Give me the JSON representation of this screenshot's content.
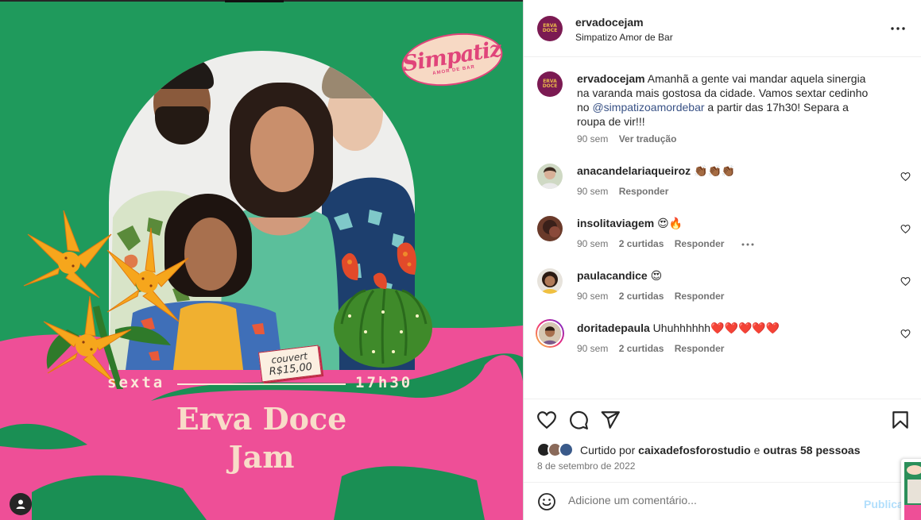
{
  "post": {
    "image": {
      "logo_badge": {
        "main": "Simpatiz",
        "sub": "AMOR DE BAR"
      },
      "ticket": {
        "line1": "couvert",
        "line2": "R$15,00"
      },
      "day": "sexta",
      "time": "17h30",
      "title_line1": "Erva Doce",
      "title_line2": "Jam",
      "colors": {
        "green": "#1f9a5c",
        "pink": "#ee4f97",
        "cream": "#f8dcc8"
      },
      "user_tag_icon": "person-icon"
    }
  },
  "header": {
    "username": "ervadocejam",
    "location": "Simpatizo Amor de Bar",
    "avatar_text": "ERVA DOCE",
    "more_icon": "more-horizontal-icon"
  },
  "caption": {
    "username": "ervadocejam",
    "text_before": " Amanhã a gente vai mandar aquela sinergia na varanda mais gostosa da cidade. Vamos sextar cedinho no ",
    "mention": "@simpatizoamordebar",
    "text_after": " a partir das 17h30! Separa a roupa de vir!!!",
    "time": "90 sem",
    "translate": "Ver tradução"
  },
  "comments": [
    {
      "username": "anacandelariaqueiroz",
      "text": " 👏🏾👏🏾👏🏾",
      "time": "90 sem",
      "likes": "",
      "reply": "Responder",
      "more": false
    },
    {
      "username": "insolitaviagem",
      "text": " 😍🔥",
      "time": "90 sem",
      "likes": "2 curtidas",
      "reply": "Responder",
      "more": true
    },
    {
      "username": "paulacandice",
      "text": " 😍",
      "time": "90 sem",
      "likes": "2 curtidas",
      "reply": "Responder",
      "more": false
    },
    {
      "username": "doritadepaula",
      "text": " Uhuhhhhhh❤️❤️❤️❤️❤️",
      "time": "90 sem",
      "likes": "2 curtidas",
      "reply": "Responder",
      "more": false
    }
  ],
  "actions": {
    "like_icon": "heart-icon",
    "comment_icon": "comment-icon",
    "share_icon": "send-icon",
    "save_icon": "bookmark-icon"
  },
  "likes": {
    "prefix": "Curtido por ",
    "user": "caixadefosforostudio",
    "middle": " e ",
    "others": "outras 58 pessoas"
  },
  "date": "8 de setembro de 2022",
  "add_comment": {
    "placeholder": "Adicione um comentário...",
    "publish": "Publicar",
    "emoji_icon": "emoji-icon"
  }
}
